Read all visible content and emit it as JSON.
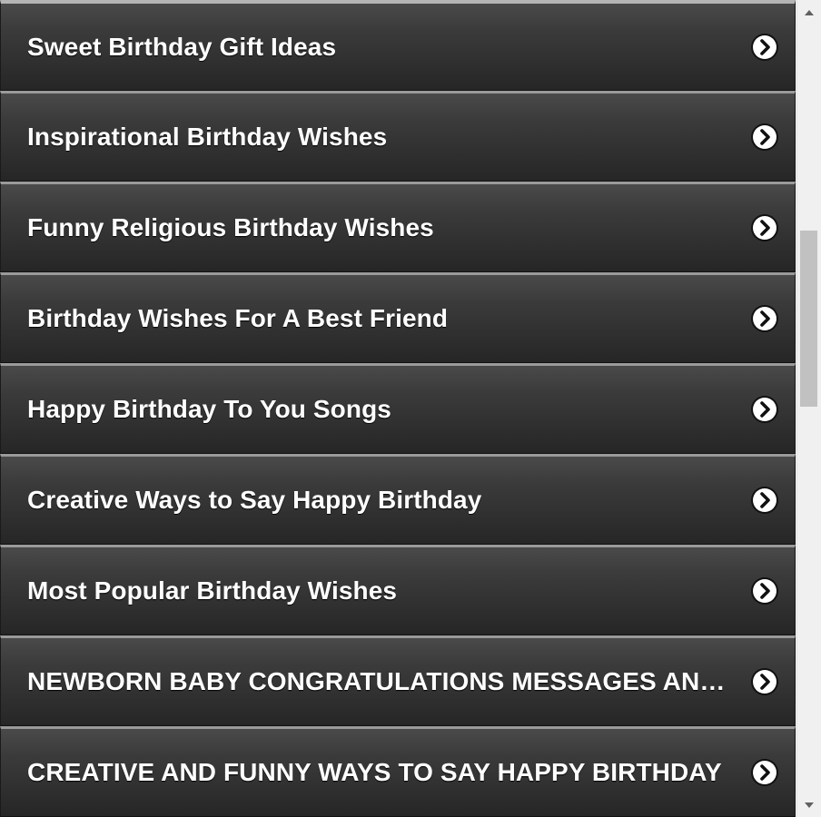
{
  "list": {
    "items": [
      {
        "label": "Sweet Birthday Gift Ideas"
      },
      {
        "label": "Inspirational Birthday Wishes"
      },
      {
        "label": "Funny Religious Birthday Wishes"
      },
      {
        "label": "Birthday Wishes For A Best Friend"
      },
      {
        "label": "Happy Birthday To You Songs"
      },
      {
        "label": "Creative Ways to Say Happy Birthday"
      },
      {
        "label": "Most Popular Birthday Wishes"
      },
      {
        "label": "NEWBORN BABY CONGRATULATIONS MESSAGES AND WISHES"
      },
      {
        "label": "CREATIVE AND FUNNY WAYS TO SAY HAPPY BIRTHDAY"
      }
    ],
    "item_icon": "chevron-right-circle-icon"
  },
  "scrollbar": {
    "up_icon": "scroll-up-arrow-icon",
    "down_icon": "scroll-down-arrow-icon"
  },
  "colors": {
    "item_background": "#333333",
    "item_text": "#ffffff",
    "item_separator": "#9a9a9a",
    "scroll_thumb": "#c1c1c1",
    "scroll_track": "#f0f0f0"
  }
}
